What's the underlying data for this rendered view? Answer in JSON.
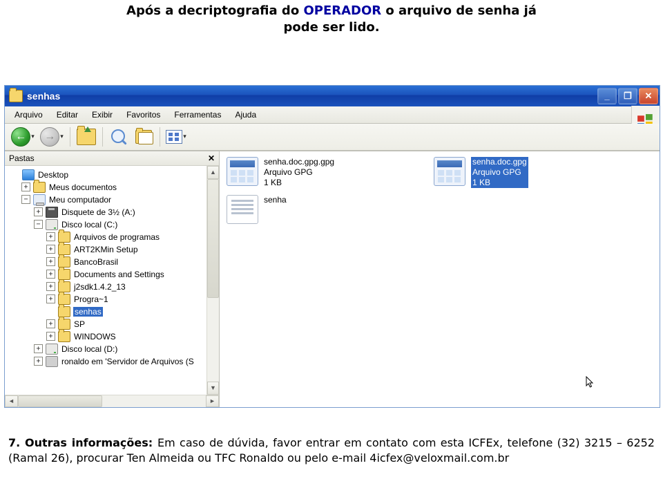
{
  "doc": {
    "line1a": "Após a decriptografia do ",
    "line1b": "OPERADOR",
    "line1c": " o arquivo de senha já",
    "line2": "pode ser lido.",
    "footer_label": "7. Outras informações: ",
    "footer_body": "Em caso de dúvida, favor entrar em contato com esta ICFEx, telefone (32) 3215 – 6252 (Ramal 26), procurar Ten Almeida ou TFC Ronaldo ou pelo e-mail 4icfex@veloxmail.com.br"
  },
  "window": {
    "title": "senhas",
    "min": "_",
    "max": "❐",
    "close": "✕"
  },
  "menu": {
    "items": [
      "Arquivo",
      "Editar",
      "Exibir",
      "Favoritos",
      "Ferramentas",
      "Ajuda"
    ]
  },
  "folders_pane": {
    "header": "Pastas",
    "close": "✕"
  },
  "tree": [
    {
      "ind": 0,
      "sq": " ",
      "icon": "desktop",
      "label": "Desktop"
    },
    {
      "ind": 1,
      "sq": "+",
      "icon": "folder",
      "label": "Meus documentos"
    },
    {
      "ind": 1,
      "sq": "−",
      "icon": "my-pc",
      "label": "Meu computador"
    },
    {
      "ind": 2,
      "sq": "+",
      "icon": "floppy",
      "label": "Disquete de 3½ (A:)"
    },
    {
      "ind": 2,
      "sq": "−",
      "icon": "disk",
      "label": "Disco local (C:)"
    },
    {
      "ind": 3,
      "sq": "+",
      "icon": "folder",
      "label": "Arquivos de programas"
    },
    {
      "ind": 3,
      "sq": "+",
      "icon": "folder",
      "label": "ART2KMin Setup"
    },
    {
      "ind": 3,
      "sq": "+",
      "icon": "folder",
      "label": "BancoBrasil"
    },
    {
      "ind": 3,
      "sq": "+",
      "icon": "folder",
      "label": "Documents and Settings"
    },
    {
      "ind": 3,
      "sq": "+",
      "icon": "folder",
      "label": "j2sdk1.4.2_13"
    },
    {
      "ind": 3,
      "sq": "+",
      "icon": "folder",
      "label": "Progra~1"
    },
    {
      "ind": 3,
      "sq": " ",
      "icon": "folder",
      "label": "senhas",
      "sel": true
    },
    {
      "ind": 3,
      "sq": "+",
      "icon": "folder",
      "label": "SP"
    },
    {
      "ind": 3,
      "sq": "+",
      "icon": "folder",
      "label": "WINDOWS"
    },
    {
      "ind": 2,
      "sq": "+",
      "icon": "disk",
      "label": "Disco local (D:)"
    },
    {
      "ind": 2,
      "sq": "+",
      "icon": "scanner",
      "label": "ronaldo em 'Servidor de Arquivos (S"
    }
  ],
  "files": [
    {
      "thumb": "doc",
      "name": "senha.doc.gpg.gpg",
      "type": "Arquivo GPG",
      "size": "1 KB",
      "sel": false
    },
    {
      "thumb": "doc",
      "name": "senha.doc.gpg",
      "type": "Arquivo GPG",
      "size": "1 KB",
      "sel": true
    },
    {
      "thumb": "txt",
      "name": "senha",
      "type": "",
      "size": "",
      "sel": false
    }
  ]
}
